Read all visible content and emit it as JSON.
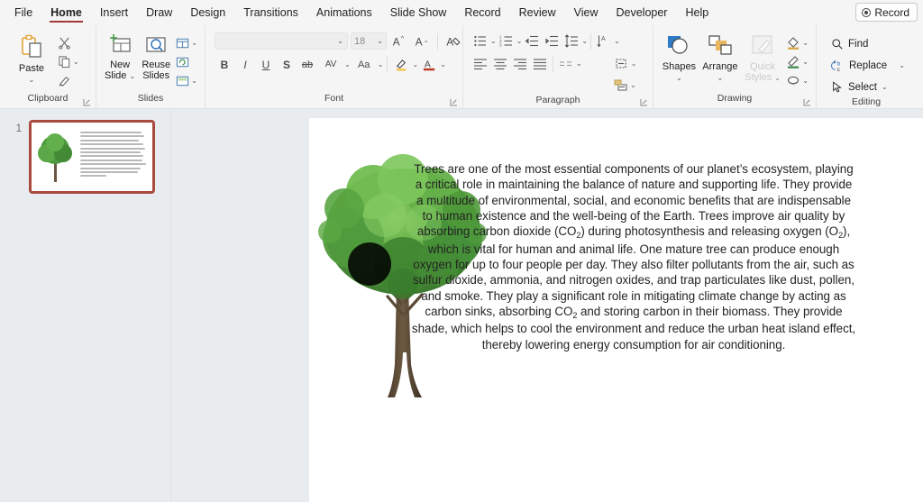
{
  "theme": {
    "accent": "#a4373a",
    "ribbon_bg": "#f5f5f5",
    "workspace_bg": "#e9ecef",
    "thumb_selected_border": "#a94a3c"
  },
  "tabs": [
    {
      "label": "File",
      "active": false
    },
    {
      "label": "Home",
      "active": true
    },
    {
      "label": "Insert",
      "active": false
    },
    {
      "label": "Draw",
      "active": false
    },
    {
      "label": "Design",
      "active": false
    },
    {
      "label": "Transitions",
      "active": false
    },
    {
      "label": "Animations",
      "active": false
    },
    {
      "label": "Slide Show",
      "active": false
    },
    {
      "label": "Record",
      "active": false
    },
    {
      "label": "Review",
      "active": false
    },
    {
      "label": "View",
      "active": false
    },
    {
      "label": "Developer",
      "active": false
    },
    {
      "label": "Help",
      "active": false
    }
  ],
  "record_button": {
    "label": "Record",
    "icon": "record-dot-icon"
  },
  "ribbon": {
    "clipboard": {
      "label": "Clipboard",
      "paste": {
        "label": "Paste",
        "icon": "clipboard-icon",
        "caret": "⌄"
      },
      "cut": {
        "icon": "scissors-icon"
      },
      "copy": {
        "icon": "copy-icon",
        "caret": "⌄"
      },
      "format_painter": {
        "icon": "format-painter-icon"
      }
    },
    "slides": {
      "label": "Slides",
      "new_slide": {
        "label_line1": "New",
        "label_line2": "Slide",
        "icon": "new-slide-icon",
        "caret": "⌄"
      },
      "reuse_slides": {
        "label_line1": "Reuse",
        "label_line2": "Slides",
        "icon": "reuse-slides-icon"
      },
      "layout": {
        "icon": "layout-icon",
        "caret": "⌄"
      },
      "reset": {
        "icon": "reset-icon"
      },
      "section": {
        "icon": "section-icon",
        "caret": "⌄"
      }
    },
    "font": {
      "label": "Font",
      "font_name": {
        "value": "",
        "placeholder": ""
      },
      "font_size": {
        "value": "18"
      },
      "increase_font": {
        "icon": "increase-font-size-icon",
        "label": "A"
      },
      "decrease_font": {
        "icon": "decrease-font-size-icon",
        "label": "A"
      },
      "clear_formatting": {
        "icon": "clear-formatting-icon"
      },
      "bold": {
        "label": "B"
      },
      "italic": {
        "label": "I"
      },
      "underline": {
        "label": "U"
      },
      "shadow": {
        "label": "S"
      },
      "strikethrough": {
        "label": "ab"
      },
      "character_spacing": {
        "label": "AV",
        "caret": "⌄"
      },
      "change_case": {
        "label": "Aa",
        "caret": "⌄"
      },
      "text_highlight": {
        "icon": "highlight-pen-icon",
        "caret": "⌄",
        "color": "#f6c244"
      },
      "font_color": {
        "icon": "font-color-icon",
        "label": "A",
        "caret": "⌄",
        "color": "#c0392b"
      }
    },
    "paragraph": {
      "label": "Paragraph",
      "bullets": {
        "icon": "bullet-list-icon",
        "caret": "⌄"
      },
      "numbering": {
        "icon": "numbered-list-icon",
        "caret": "⌄"
      },
      "decrease_indent": {
        "icon": "decrease-indent-icon"
      },
      "increase_indent": {
        "icon": "increase-indent-icon"
      },
      "line_spacing": {
        "icon": "line-spacing-icon",
        "caret": "⌄"
      },
      "align_left": {
        "icon": "align-left-icon"
      },
      "align_center": {
        "icon": "align-center-icon"
      },
      "align_right": {
        "icon": "align-right-icon"
      },
      "justify": {
        "icon": "justify-icon"
      },
      "columns": {
        "icon": "columns-icon",
        "caret": "⌄"
      },
      "text_direction": {
        "icon": "text-direction-icon",
        "caret": "⌄"
      },
      "align_text": {
        "icon": "align-text-icon",
        "caret": "⌄"
      },
      "convert_smartart": {
        "icon": "smartart-icon",
        "caret": "⌄"
      }
    },
    "drawing": {
      "label": "Drawing",
      "shapes": {
        "label": "Shapes",
        "icon": "shapes-icon",
        "caret": "⌄"
      },
      "arrange": {
        "label": "Arrange",
        "icon": "arrange-icon",
        "caret": "⌄"
      },
      "quick_styles": {
        "label_line1": "Quick",
        "label_line2": "Styles",
        "icon": "quick-styles-icon",
        "caret": "⌄",
        "disabled": true
      },
      "shape_fill": {
        "icon": "shape-fill-icon",
        "caret": "⌄"
      },
      "shape_outline": {
        "icon": "shape-outline-icon",
        "caret": "⌄"
      },
      "shape_effects": {
        "icon": "shape-effects-icon",
        "caret": "⌄"
      }
    },
    "editing": {
      "label": "Editing",
      "find": {
        "label": "Find",
        "icon": "search-icon"
      },
      "replace": {
        "label": "Replace",
        "icon": "replace-icon",
        "caret": "⌄"
      },
      "select": {
        "label": "Select",
        "icon": "select-cursor-icon",
        "caret": "⌄"
      }
    }
  },
  "thumbnails": [
    {
      "number": "1",
      "selected": true
    }
  ],
  "slide": {
    "image": {
      "name": "tree-image",
      "alt": "green broadleaf tree"
    },
    "body_text_parts": [
      "Trees are one of the most essential components of our planet’s ecosystem, playing a critical role in maintaining the balance of nature and supporting life. They provide a multitude of environmental, social, and economic benefits that are indispensable to human existence and the well-being of the Earth. Trees improve air quality by absorbing carbon dioxide (CO",
      "2",
      ") during photosynthesis and releasing oxygen (O",
      "2",
      "), which is vital for human and animal life. One mature tree can produce enough oxygen for up to four people per day. They also filter pollutants from the air, such as sulfur dioxide, ammonia, and nitrogen oxides, and trap particulates like dust, pollen, and smoke. They play a significant role in mitigating climate change by acting as carbon sinks, absorbing CO",
      "2",
      " and storing carbon in their biomass. They provide shade, which helps to cool the environment and reduce the urban heat island effect, thereby lowering energy consumption for air conditioning."
    ]
  }
}
